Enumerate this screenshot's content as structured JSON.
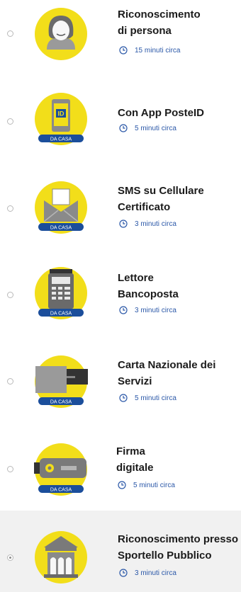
{
  "options": [
    {
      "title_line1": "Riconoscimento",
      "title_line2": "di persona",
      "time": "15 minuti circa",
      "badge": "",
      "selected": false,
      "icon": "person-icon"
    },
    {
      "title_line1": "Con App PosteID",
      "title_line2": "",
      "time": "5 minuti circa",
      "badge": "DA CASA",
      "selected": false,
      "icon": "posteid-app-icon",
      "id_text": "ID"
    },
    {
      "title_line1": "SMS su Cellulare",
      "title_line2": "Certificato",
      "time": "3 minuti circa",
      "badge": "DA CASA",
      "selected": false,
      "icon": "sms-envelope-icon"
    },
    {
      "title_line1": "Lettore",
      "title_line2": "Bancoposta",
      "time": "3 minuti circa",
      "badge": "DA CASA",
      "selected": false,
      "icon": "card-reader-icon"
    },
    {
      "title_line1": "Carta Nazionale dei",
      "title_line2": "Servizi",
      "time": "5 minuti circa",
      "badge": "DA CASA",
      "selected": false,
      "icon": "national-card-icon"
    },
    {
      "title_line1": "Firma",
      "title_line2": "digitale",
      "time": "5 minuti circa",
      "badge": "DA CASA",
      "selected": false,
      "icon": "usb-key-icon"
    },
    {
      "title_line1": "Riconoscimento presso",
      "title_line2": "Sportello Pubblico",
      "time": "3 minuti circa",
      "badge": "",
      "selected": true,
      "icon": "bank-building-icon"
    }
  ],
  "colors": {
    "yellow": "#f2de1a",
    "blue": "#1b4e9b",
    "time_text": "#2b58a8",
    "selected_bg": "#f1f1f1"
  }
}
